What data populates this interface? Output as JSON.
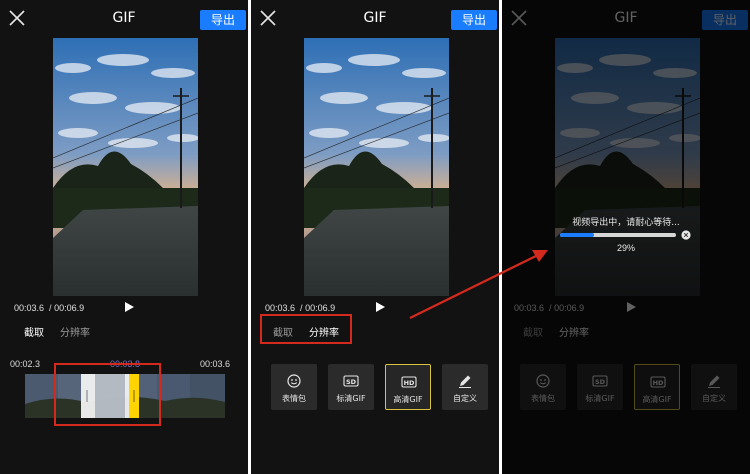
{
  "header": {
    "title": "GIF",
    "export_label": "导出"
  },
  "player": {
    "current_time": "00:03.6",
    "separator": "/",
    "total_time": "00:06.9"
  },
  "tabs": {
    "trim": "截取",
    "resolution": "分辨率"
  },
  "timeline": {
    "start": "00:02.3",
    "middle": "00:03.8",
    "end": "00:03.6"
  },
  "options": [
    {
      "label": "表情包",
      "icon": "smiley-icon"
    },
    {
      "label": "标清GIF",
      "icon": "sd-icon",
      "icon_text": "SD"
    },
    {
      "label": "高清GIF",
      "icon": "hd-icon",
      "icon_text": "HD"
    },
    {
      "label": "自定义",
      "icon": "pencil-icon"
    }
  ],
  "selected_option": "高清GIF",
  "export_progress": {
    "message": "视频导出中，请耐心等待...",
    "percent_text": "29%",
    "percent": 29
  },
  "colors": {
    "accent": "#1a7cff",
    "highlight": "#d42a1e",
    "trim_handle": "#ffd400"
  }
}
